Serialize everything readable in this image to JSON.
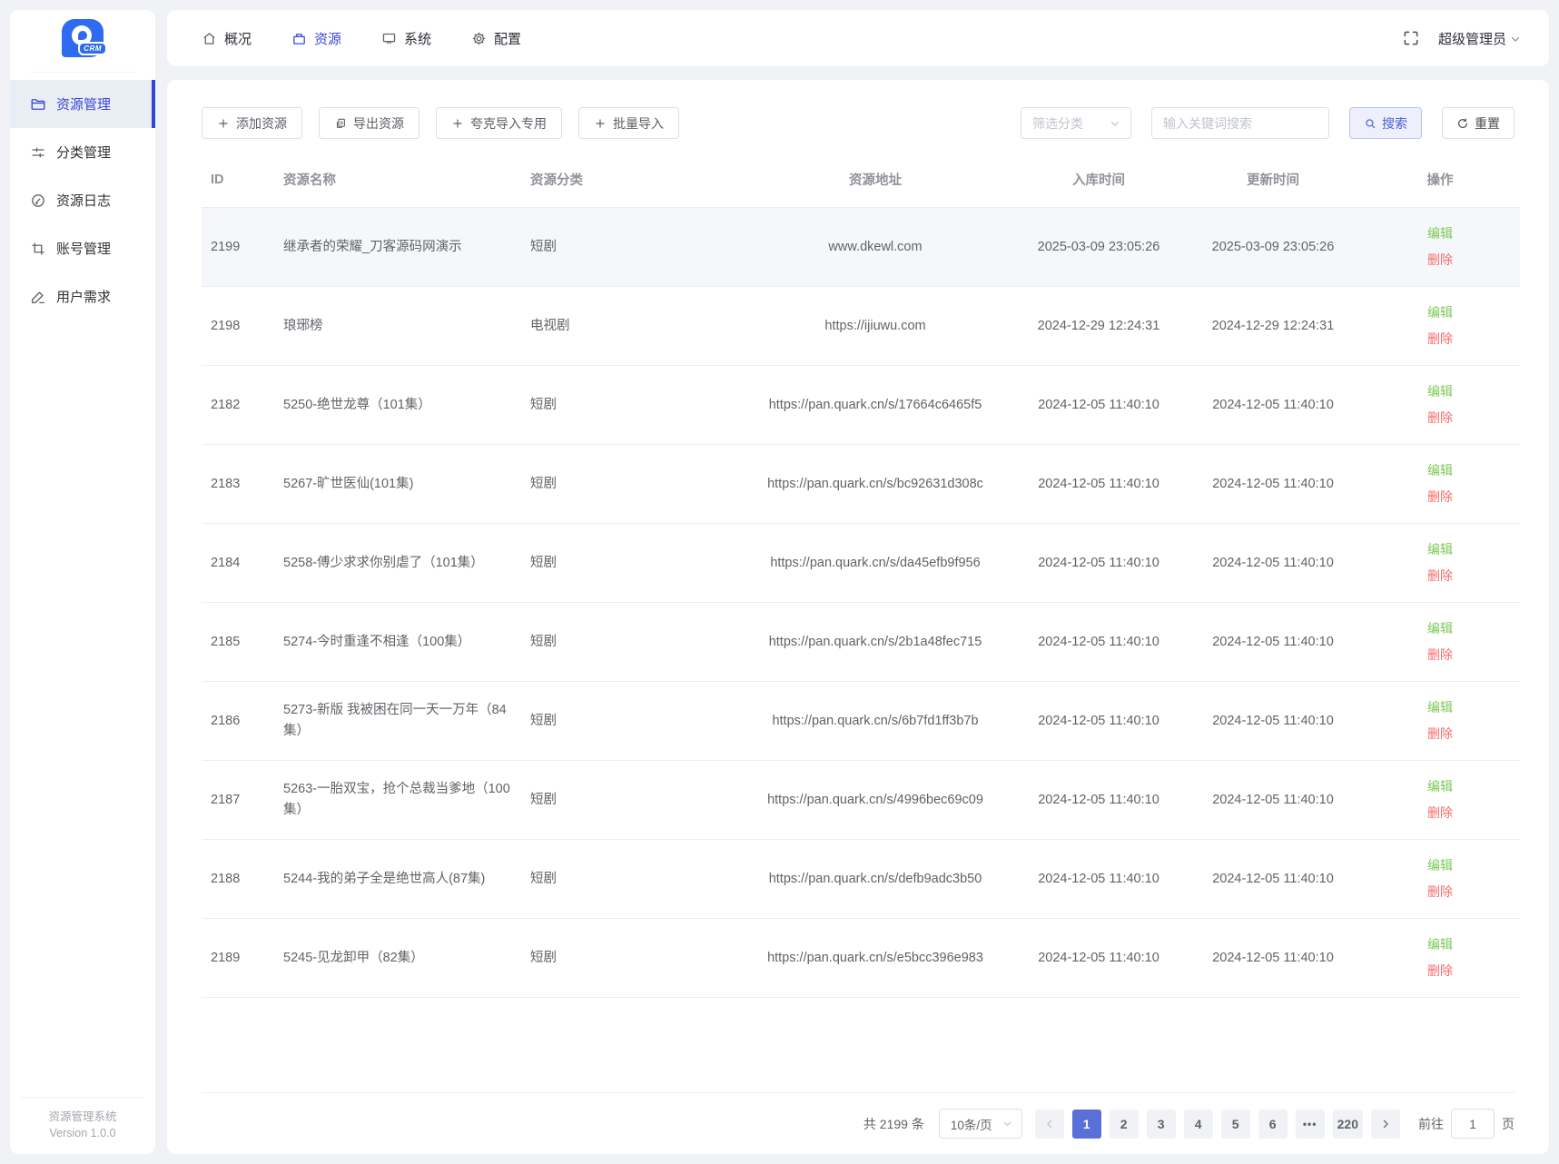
{
  "app": {
    "logo_text": "CRM",
    "footer_line1": "资源管理系统",
    "footer_line2": "Version 1.0.0"
  },
  "topnav": {
    "items": [
      {
        "label": "概况"
      },
      {
        "label": "资源"
      },
      {
        "label": "系统"
      },
      {
        "label": "配置"
      }
    ],
    "user": "超级管理员"
  },
  "sidebar": {
    "items": [
      {
        "label": "资源管理"
      },
      {
        "label": "分类管理"
      },
      {
        "label": "资源日志"
      },
      {
        "label": "账号管理"
      },
      {
        "label": "用户需求"
      }
    ]
  },
  "toolbar": {
    "add_label": "添加资源",
    "export_label": "导出资源",
    "quark_label": "夸克导入专用",
    "batch_label": "批量导入"
  },
  "filters": {
    "category_placeholder": "筛选分类",
    "keyword_placeholder": "输入关键词搜索",
    "search_label": "搜索",
    "reset_label": "重置"
  },
  "table": {
    "columns": [
      "ID",
      "资源名称",
      "资源分类",
      "资源地址",
      "入库时间",
      "更新时间",
      "操作"
    ],
    "actions": {
      "edit": "编辑",
      "delete": "删除"
    },
    "rows": [
      {
        "id": "2199",
        "name": "继承者的荣耀_刀客源码网演示",
        "category": "短剧",
        "url": "www.dkewl.com",
        "created": "2025-03-09 23:05:26",
        "updated": "2025-03-09 23:05:26"
      },
      {
        "id": "2198",
        "name": "琅琊榜",
        "category": "电视剧",
        "url": "https://ijiuwu.com",
        "created": "2024-12-29 12:24:31",
        "updated": "2024-12-29 12:24:31"
      },
      {
        "id": "2182",
        "name": "5250-绝世龙尊（101集）",
        "category": "短剧",
        "url": "https://pan.quark.cn/s/17664c6465f5",
        "created": "2024-12-05 11:40:10",
        "updated": "2024-12-05 11:40:10"
      },
      {
        "id": "2183",
        "name": "5267-旷世医仙(101集)",
        "category": "短剧",
        "url": "https://pan.quark.cn/s/bc92631d308c",
        "created": "2024-12-05 11:40:10",
        "updated": "2024-12-05 11:40:10"
      },
      {
        "id": "2184",
        "name": "5258-傅少求求你别虐了（101集）",
        "category": "短剧",
        "url": "https://pan.quark.cn/s/da45efb9f956",
        "created": "2024-12-05 11:40:10",
        "updated": "2024-12-05 11:40:10"
      },
      {
        "id": "2185",
        "name": "5274-今时重逢不相逢（100集）",
        "category": "短剧",
        "url": "https://pan.quark.cn/s/2b1a48fec715",
        "created": "2024-12-05 11:40:10",
        "updated": "2024-12-05 11:40:10"
      },
      {
        "id": "2186",
        "name": "5273-新版 我被困在同一天一万年（84集）",
        "category": "短剧",
        "url": "https://pan.quark.cn/s/6b7fd1ff3b7b",
        "created": "2024-12-05 11:40:10",
        "updated": "2024-12-05 11:40:10"
      },
      {
        "id": "2187",
        "name": "5263-一胎双宝，抢个总裁当爹地（100集）",
        "category": "短剧",
        "url": "https://pan.quark.cn/s/4996bec69c09",
        "created": "2024-12-05 11:40:10",
        "updated": "2024-12-05 11:40:10"
      },
      {
        "id": "2188",
        "name": "5244-我的弟子全是绝世高人(87集)",
        "category": "短剧",
        "url": "https://pan.quark.cn/s/defb9adc3b50",
        "created": "2024-12-05 11:40:10",
        "updated": "2024-12-05 11:40:10"
      },
      {
        "id": "2189",
        "name": "5245-见龙卸甲（82集）",
        "category": "短剧",
        "url": "https://pan.quark.cn/s/e5bcc396e983",
        "created": "2024-12-05 11:40:10",
        "updated": "2024-12-05 11:40:10"
      }
    ]
  },
  "pagination": {
    "total_text": "共 2199 条",
    "page_size": "10条/页",
    "pages": [
      "1",
      "2",
      "3",
      "4",
      "5",
      "6"
    ],
    "ellipsis": "•••",
    "last_page": "220",
    "goto_label": "前往",
    "goto_value": "1",
    "goto_suffix": "页"
  },
  "colors": {
    "accent": "#3a49d6",
    "pagination_active": "#5a6fd8",
    "success": "#7dc855",
    "danger": "#f56c6c",
    "page_bg": "#f0f2f5"
  }
}
